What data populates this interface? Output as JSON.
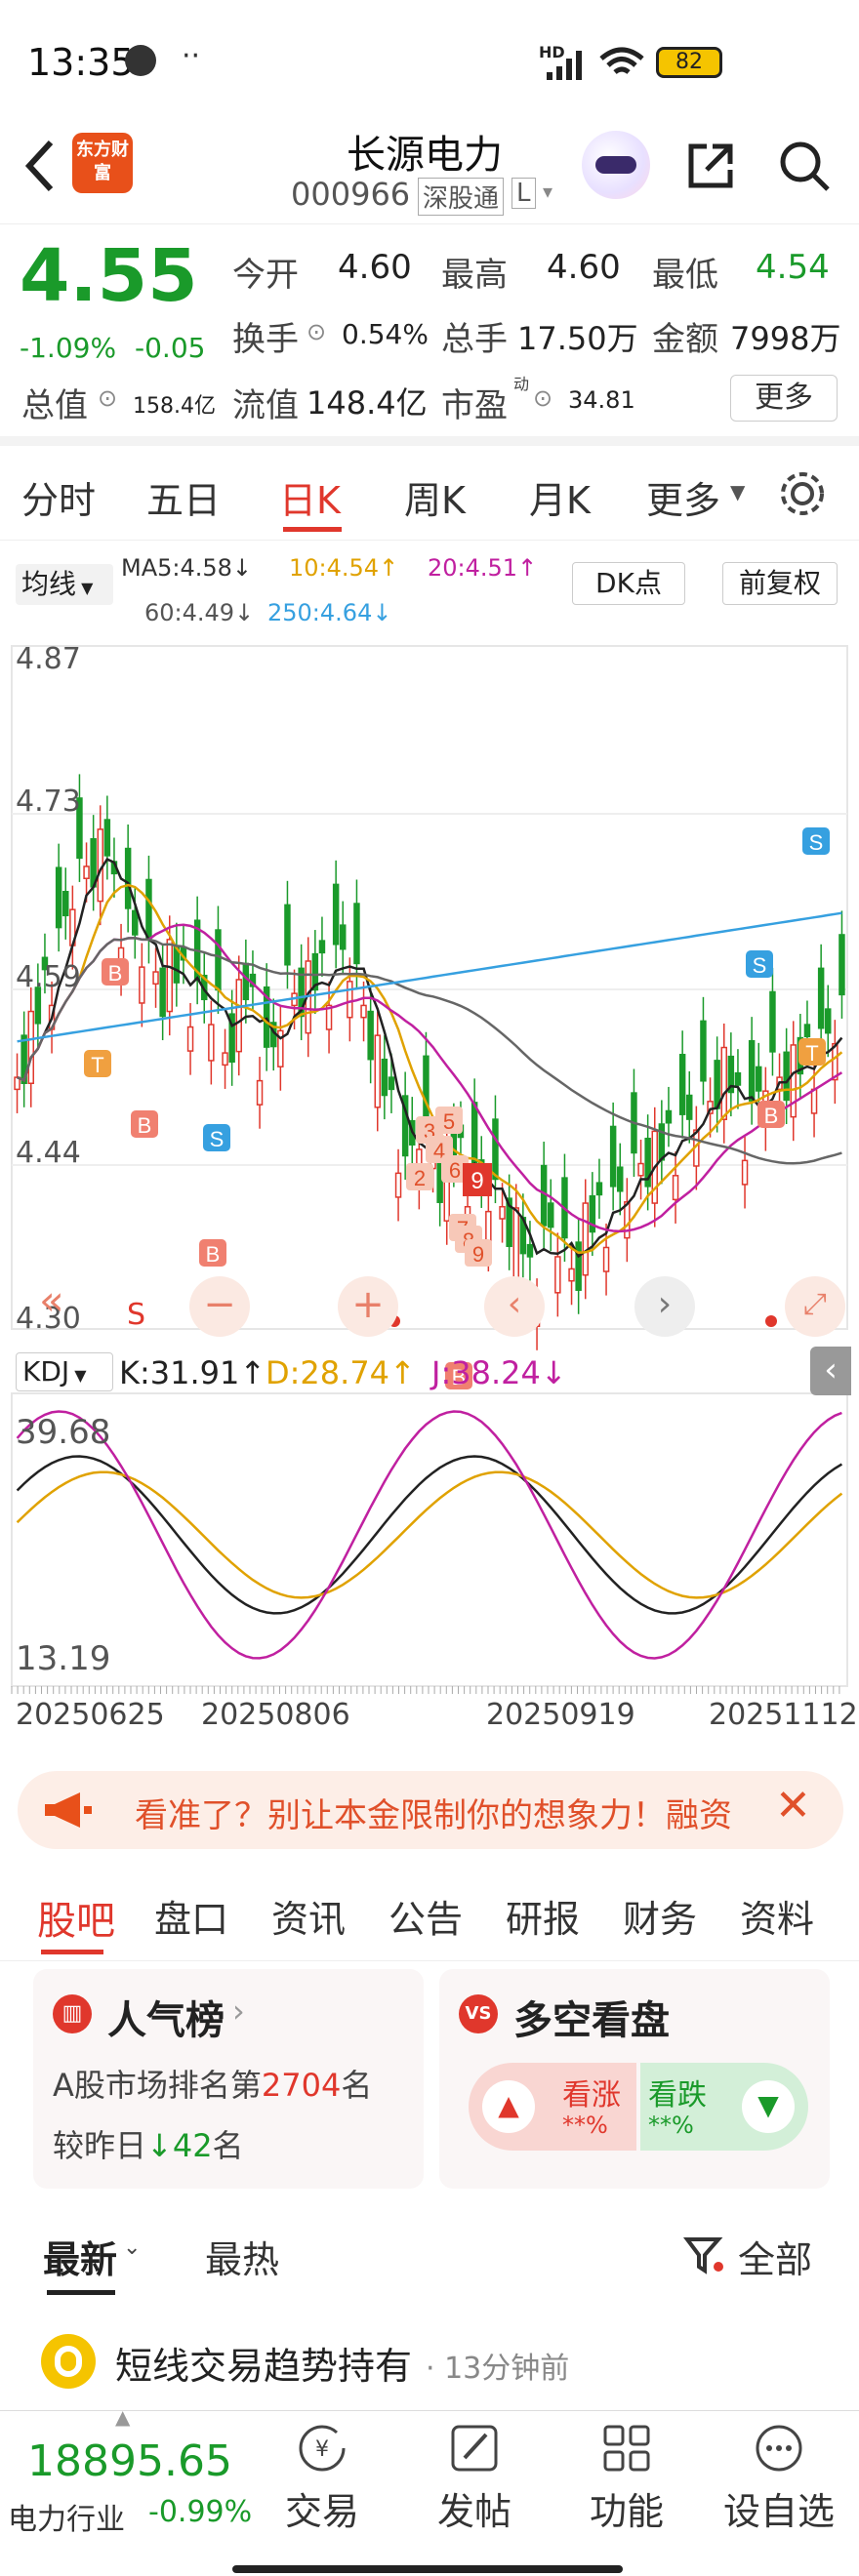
{
  "status_bar": {
    "time": "13:35",
    "battery": "82",
    "network": "HD"
  },
  "header": {
    "title": "长源电力",
    "code": "000966",
    "tag1": "深股通",
    "tag2": "L",
    "logo_text": "东方财富"
  },
  "quote": {
    "price": "4.55",
    "change_pct": "-1.09%",
    "change": "-0.05",
    "open_label": "今开",
    "open": "4.60",
    "high_label": "最高",
    "high": "4.60",
    "low_label": "最低",
    "low": "4.54",
    "turnover_label": "换手",
    "turnover": "0.54%",
    "volume_label": "总手",
    "volume": "17.50万",
    "amount_label": "金额",
    "amount": "7998万",
    "mktcap_label": "总值",
    "mktcap": "158.4亿",
    "float_label": "流值",
    "float": "148.4亿",
    "pe_label": "市盈",
    "pe_sup": "动",
    "pe": "34.81",
    "more_button": "更多"
  },
  "kline_tabs": [
    "分时",
    "五日",
    "日K",
    "周K",
    "月K",
    "更多"
  ],
  "ma_bar": {
    "select": "均线",
    "ma5": "MA5:4.58↓",
    "ma10": "10:4.54↑",
    "ma20": "20:4.51↑",
    "ma60": "60:4.49↓",
    "ma250": "250:4.64↓",
    "dk_button": "DK点",
    "adjust_button": "前复权"
  },
  "chart_data": {
    "type": "candlestick",
    "y_ticks": [
      "4.87",
      "4.73",
      "4.59",
      "4.44",
      "4.30"
    ],
    "ylim": [
      4.3,
      4.87
    ],
    "signal_labels": {
      "buy": "B",
      "sell": "S",
      "t": "T"
    },
    "sequence_numbers": [
      "2",
      "3",
      "4",
      "5",
      "6",
      "7",
      "8",
      "9"
    ],
    "kdj": {
      "select": "KDJ",
      "k": "K:31.91↑",
      "d": "D:28.74↑",
      "j": "J:38.24↓",
      "y_ticks": [
        "39.68",
        "13.19"
      ]
    },
    "dates": [
      "20250625",
      "20250806",
      "20250919",
      "20251112"
    ],
    "toolbar_s": "S"
  },
  "ad": {
    "text": "看准了？别让本金限制你的想象力！融资"
  },
  "section_tabs": [
    "股吧",
    "盘口",
    "资讯",
    "公告",
    "研报",
    "财务",
    "资料"
  ],
  "popularity": {
    "title": "人气榜",
    "line1_prefix": "A股市场排名第",
    "rank": "2704",
    "line1_suffix": "名",
    "line2_prefix": "较昨日",
    "change": "42",
    "line2_suffix": "名"
  },
  "sentiment": {
    "title": "多空看盘",
    "bull_label": "看涨",
    "bull_value": "**%",
    "bear_label": "看跌",
    "bear_value": "**%"
  },
  "filter": {
    "latest": "最新",
    "hot": "最热",
    "all": "全部"
  },
  "post": {
    "title": "短线交易趋势持有",
    "time": "13分钟前"
  },
  "bottom_bar": {
    "index_value": "18895.65",
    "index_name": "电力行业",
    "index_change": "-0.99%",
    "items": [
      "交易",
      "发帖",
      "功能",
      "设自选"
    ]
  },
  "colors": {
    "up": "#e0372c",
    "down": "#1a9a2a",
    "ma10": "#e0a200",
    "ma20": "#c020a0",
    "ma250": "#36a0e0",
    "accent": "#e0372c"
  }
}
